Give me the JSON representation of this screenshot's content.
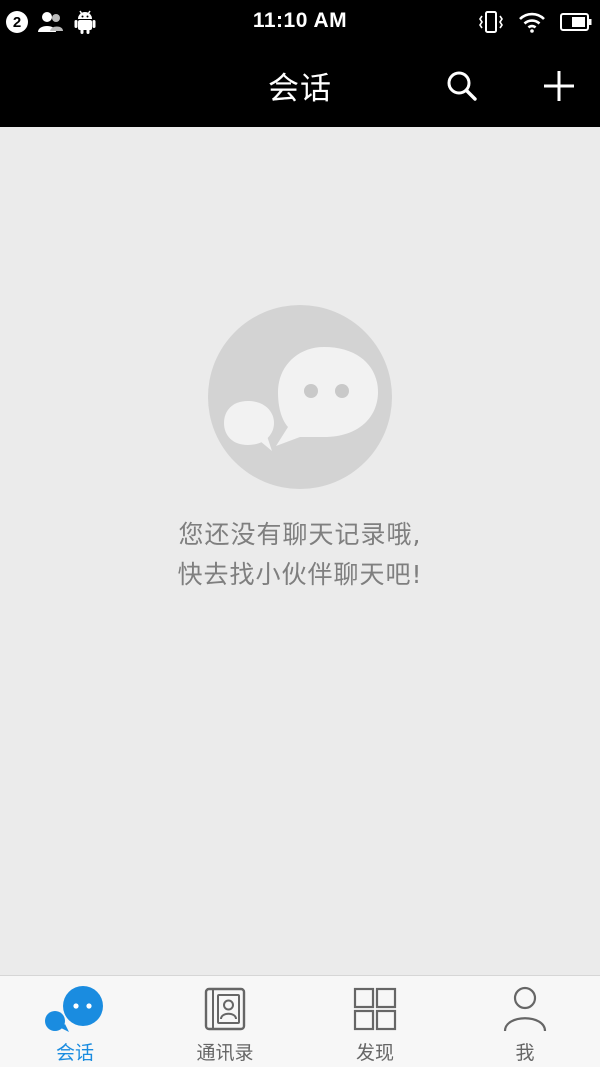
{
  "status_bar": {
    "notification_count": "2",
    "time": "11:10 AM",
    "icons": [
      "contacts-notify-icon",
      "android-icon",
      "vibrate-icon",
      "wifi-icon",
      "battery-icon"
    ]
  },
  "header": {
    "title": "会话",
    "search_icon": "search-icon",
    "add_icon": "plus-icon"
  },
  "empty_state": {
    "icon": "chat-bubbles-icon",
    "line1": "您还没有聊天记录哦,",
    "line2": "快去找小伙伴聊天吧!"
  },
  "bottom_nav": {
    "items": [
      {
        "label": "会话",
        "icon": "chat-bubbles-icon",
        "active": true
      },
      {
        "label": "通讯录",
        "icon": "address-book-icon",
        "active": false
      },
      {
        "label": "发现",
        "icon": "grid-icon",
        "active": false
      },
      {
        "label": "我",
        "icon": "person-icon",
        "active": false
      }
    ]
  },
  "colors": {
    "header_bg": "#000000",
    "content_bg": "#ebebeb",
    "active_tab": "#1a8ce0",
    "inactive_tab": "#666666",
    "empty_text": "#7f7f7f",
    "illustration": "#d3d3d3"
  }
}
